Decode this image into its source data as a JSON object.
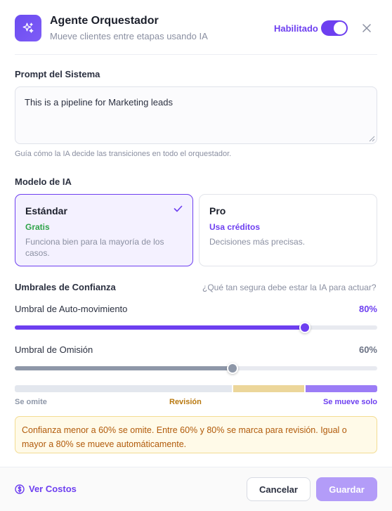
{
  "header": {
    "title": "Agente Orquestador",
    "subtitle": "Mueve clientes entre etapas usando IA",
    "enabled_label": "Habilitado",
    "enabled": true,
    "icon": "sparkles-icon",
    "close_icon": "close-icon"
  },
  "prompt": {
    "label": "Prompt del Sistema",
    "value": "This is a pipeline for Marketing leads",
    "hint": "Guía cómo la IA decide las transiciones en todo el orquestador."
  },
  "model": {
    "label": "Modelo de IA",
    "options": [
      {
        "name": "Estándar",
        "price": "Gratis",
        "description": "Funciona bien para la mayoría de los casos.",
        "selected": true
      },
      {
        "name": "Pro",
        "price": "Usa créditos",
        "description": "Decisiones más precisas.",
        "selected": false
      }
    ]
  },
  "thresholds": {
    "label": "Umbrales de Confianza",
    "note": "¿Qué tan segura debe estar la IA para actuar?",
    "auto_move": {
      "label": "Umbral de Auto-movimiento",
      "value_text": "80%",
      "value": 80
    },
    "omit": {
      "label": "Umbral de Omisión",
      "value_text": "60%",
      "value": 60
    },
    "zones": {
      "omit": "Se omite",
      "review": "Revisión",
      "auto": "Se mueve solo"
    },
    "info": "Confianza menor a 60% se omite. Entre 60% y 80% se marca para revisión. Igual o mayor a 80% se mueve automáticamente."
  },
  "footer": {
    "costs_label": "Ver Costos",
    "cancel_label": "Cancelar",
    "save_label": "Guardar"
  },
  "colors": {
    "accent": "#6d3ff0",
    "free_green": "#2fa34a",
    "review_amber": "#b8780f",
    "omit_gray": "#8e97a8"
  }
}
